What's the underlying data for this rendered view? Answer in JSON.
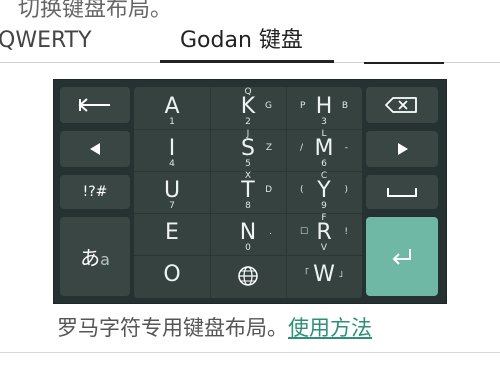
{
  "header": {
    "top_text": "切换键盘布局。"
  },
  "tabs": [
    {
      "label": "QWERTY",
      "selected": false
    },
    {
      "label": "Godan 键盘",
      "selected": true
    }
  ],
  "keyboard": {
    "left_keys": [
      {
        "name": "backspace-left-arrow",
        "label": "⟵"
      },
      {
        "name": "cursor-left",
        "label": "◀"
      },
      {
        "name": "symbols",
        "label": "!?#"
      },
      {
        "name": "kana-switch",
        "label": "あa"
      }
    ],
    "right_keys": [
      {
        "name": "delete",
        "label": "⌫"
      },
      {
        "name": "cursor-right",
        "label": "▶"
      },
      {
        "name": "space",
        "label": "⎵"
      },
      {
        "name": "enter",
        "label": "↵"
      }
    ],
    "grid": [
      {
        "main": "A",
        "top": "",
        "bottom": "1",
        "left": "",
        "right": ""
      },
      {
        "main": "K",
        "top": "Q",
        "bottom": "2",
        "left": "",
        "right": "G"
      },
      {
        "main": "H",
        "top": "",
        "bottom": "3",
        "left": "P",
        "right": "B"
      },
      {
        "main": "I",
        "top": "",
        "bottom": "4",
        "left": "",
        "right": ""
      },
      {
        "main": "S",
        "top": "J",
        "bottom": "5",
        "left": "",
        "right": "Z"
      },
      {
        "main": "M",
        "top": "L",
        "bottom": "6",
        "left": "/",
        "right": "-"
      },
      {
        "main": "U",
        "top": "",
        "bottom": "7",
        "left": "",
        "right": ""
      },
      {
        "main": "T",
        "top": "X",
        "bottom": "8",
        "left": "",
        "right": "D"
      },
      {
        "main": "Y",
        "top": "C",
        "bottom": "9",
        "left": "(",
        "right": ")"
      },
      {
        "main": "E",
        "top": "",
        "bottom": "",
        "left": "",
        "right": ""
      },
      {
        "main": "N",
        "top": "",
        "bottom": "0",
        "left": "",
        "right": "."
      },
      {
        "main": "R",
        "top": "F",
        "bottom": "V",
        "left": "☐",
        "right": "!"
      },
      {
        "main": "O",
        "top": "",
        "bottom": "",
        "left": "",
        "right": ""
      },
      {
        "main": "🌐",
        "top": "",
        "bottom": "",
        "left": "",
        "right": ""
      },
      {
        "main": "W",
        "top": "",
        "bottom": "",
        "left": "「",
        "right": "」"
      }
    ]
  },
  "caption": {
    "text": "罗马字符专用键盘布局。",
    "link": "使用方法"
  },
  "colors": {
    "keyboard_bg": "#263232",
    "key_bg": "#36423f",
    "enter_bg": "#6fb8a6",
    "link": "#2f8f78"
  }
}
